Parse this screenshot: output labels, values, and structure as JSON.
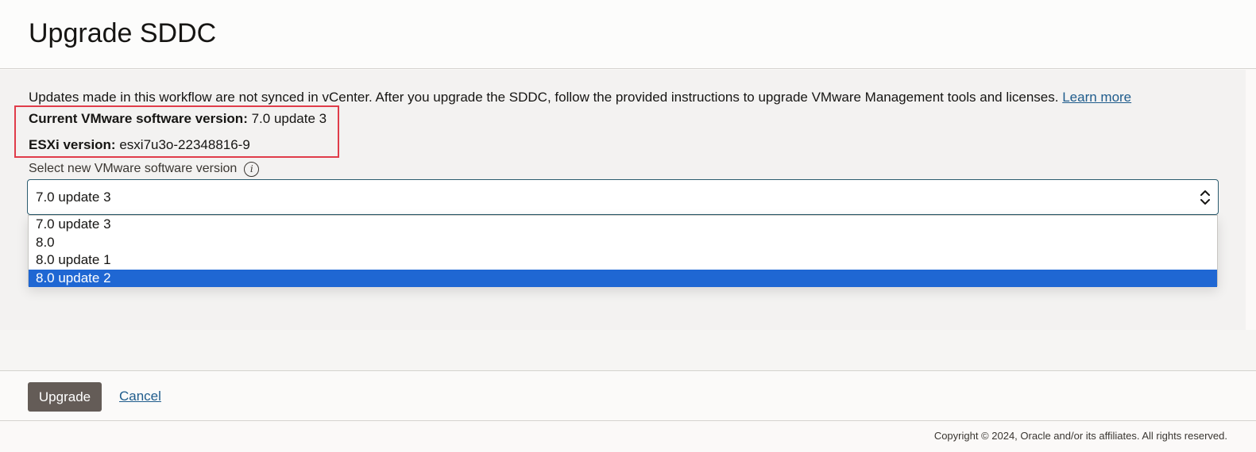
{
  "header": {
    "title": "Upgrade SDDC"
  },
  "info": {
    "text": "Updates made in this workflow are not synced in vCenter. After you upgrade the SDDC, follow the provided instructions to upgrade VMware Management tools and licenses. ",
    "learn_more": "Learn more"
  },
  "current": {
    "vmware_label": "Current VMware software version:",
    "vmware_value": " 7.0 update 3",
    "esxi_label": "ESXi version:",
    "esxi_value": " esxi7u3o-22348816-9"
  },
  "version_select": {
    "label": "Select new VMware software version",
    "value": "7.0 update 3",
    "options": [
      "7.0 update 3",
      "8.0",
      "8.0 update 1",
      "8.0 update 2"
    ],
    "highlighted_option": "8.0 update 2"
  },
  "actions": {
    "upgrade": "Upgrade",
    "cancel": "Cancel"
  },
  "footer": {
    "copyright": "Copyright © 2024, Oracle and/or its affiliates. All rights reserved."
  },
  "colors": {
    "highlight_border": "#e03c4a",
    "selected_option": "#1f67d3",
    "primary_button": "#645c57",
    "link": "#1f5c8c"
  }
}
